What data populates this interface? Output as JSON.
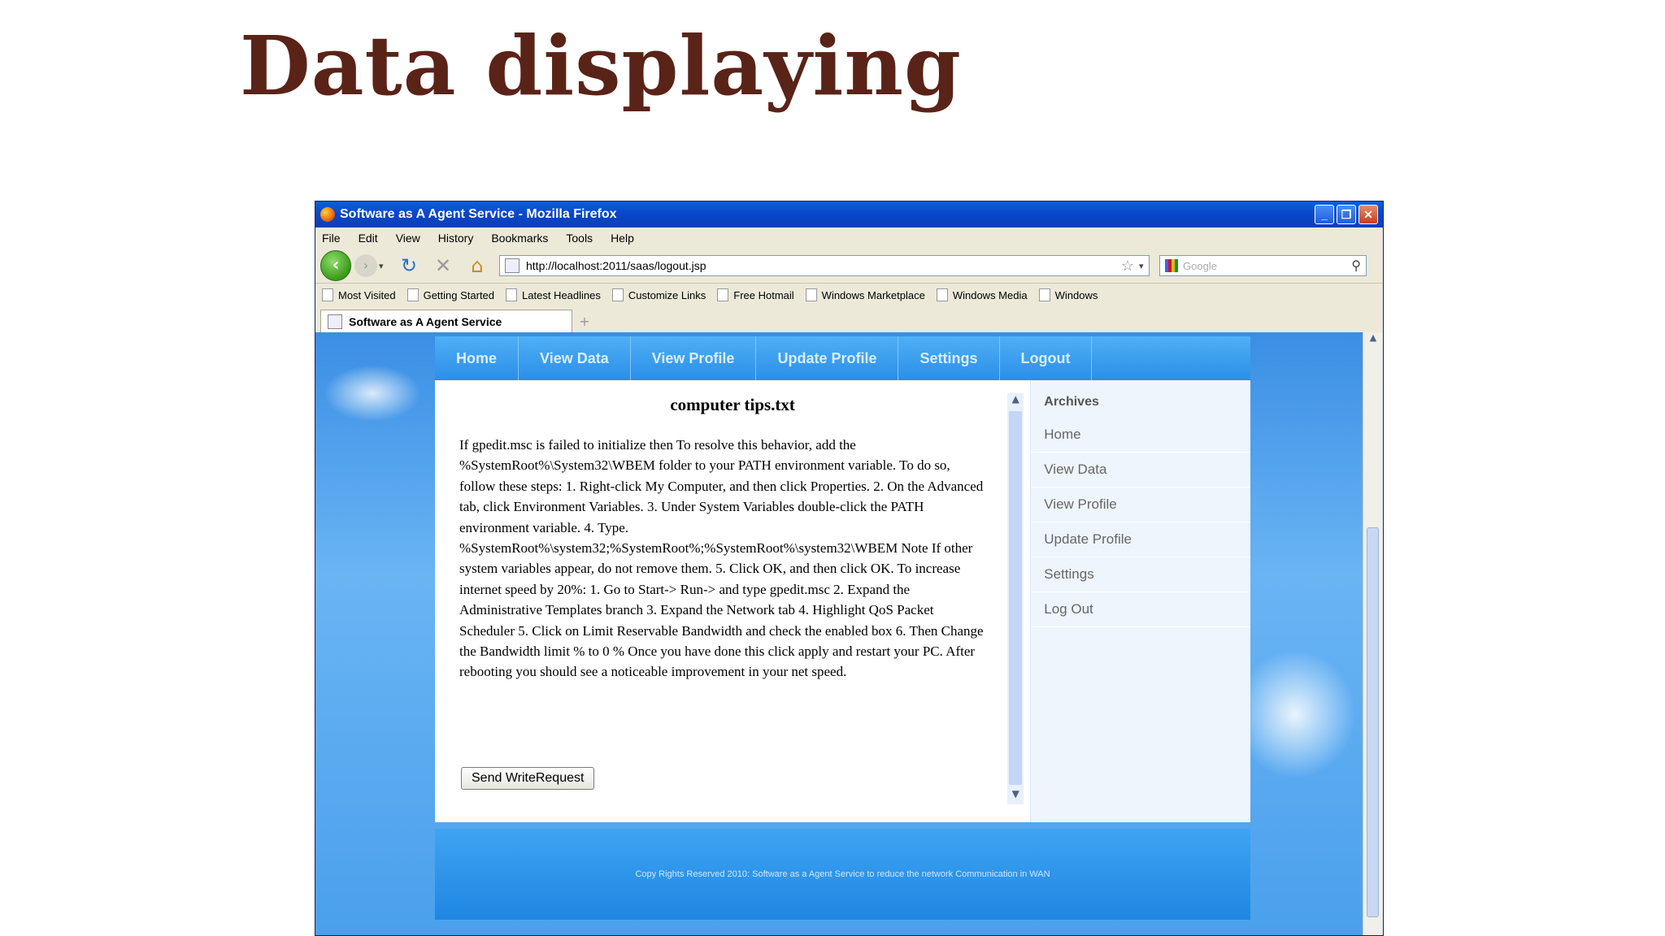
{
  "slide": {
    "title": "Data displaying"
  },
  "window": {
    "title": "Software as A Agent Service - Mozilla Firefox",
    "buttons": {
      "minimize": "_",
      "restore": "❐",
      "close": "✕"
    }
  },
  "menu": [
    "File",
    "Edit",
    "View",
    "History",
    "Bookmarks",
    "Tools",
    "Help"
  ],
  "toolbar": {
    "url": "http://localhost:2011/saas/logout.jsp",
    "search_placeholder": "Google",
    "back": "‹",
    "forward": "›",
    "reload": "↻",
    "stop": "✕",
    "home": "⌂",
    "bookmark_star": "☆",
    "search_glass": "⚲"
  },
  "bookmarks": [
    "Most Visited",
    "Getting Started",
    "Latest Headlines",
    "Customize Links",
    "Free Hotmail",
    "Windows Marketplace",
    "Windows Media",
    "Windows"
  ],
  "tabs": [
    {
      "label": "Software as A Agent Service"
    }
  ],
  "new_tab": "+",
  "site": {
    "nav": [
      "Home",
      "View Data",
      "View Profile",
      "Update Profile",
      "Settings",
      "Logout"
    ],
    "document": {
      "title": "computer tips.txt",
      "body": "If gpedit.msc is failed to initialize then To resolve this behavior, add the %SystemRoot%\\System32\\WBEM folder to your PATH environment variable. To do so, follow these steps: 1. Right-click My Computer, and then click Properties. 2. On the Advanced tab, click Environment Variables. 3. Under System Variables double-click the PATH environment variable. 4. Type. %SystemRoot%\\system32;%SystemRoot%;%SystemRoot%\\system32\\WBEM Note If other system variables appear, do not remove them. 5. Click OK, and then click OK. To increase internet speed by 20%: 1. Go to Start-> Run-> and type gpedit.msc 2. Expand the Administrative Templates branch 3. Expand the Network tab 4. Highlight QoS Packet Scheduler 5. Click on Limit Reservable Bandwidth and check the enabled box 6. Then Change the Bandwidth limit % to 0 % Once you have done this click apply and restart your PC. After rebooting you should see a noticeable improvement in your net speed."
    },
    "send_button": "Send WriteRequest",
    "sidebar": {
      "title": "Archives",
      "items": [
        "Home",
        "View Data",
        "View Profile",
        "Update Profile",
        "Settings",
        "Log Out"
      ]
    },
    "footer": "Copy Rights Reserved 2010: Software as a Agent Service to reduce the network Communication in WAN"
  },
  "scroll": {
    "up": "▲",
    "down": "▼"
  },
  "colors": {
    "title": "#5a2318",
    "titlebar": "#0a46c8",
    "site_nav": "#2b8ee8"
  }
}
